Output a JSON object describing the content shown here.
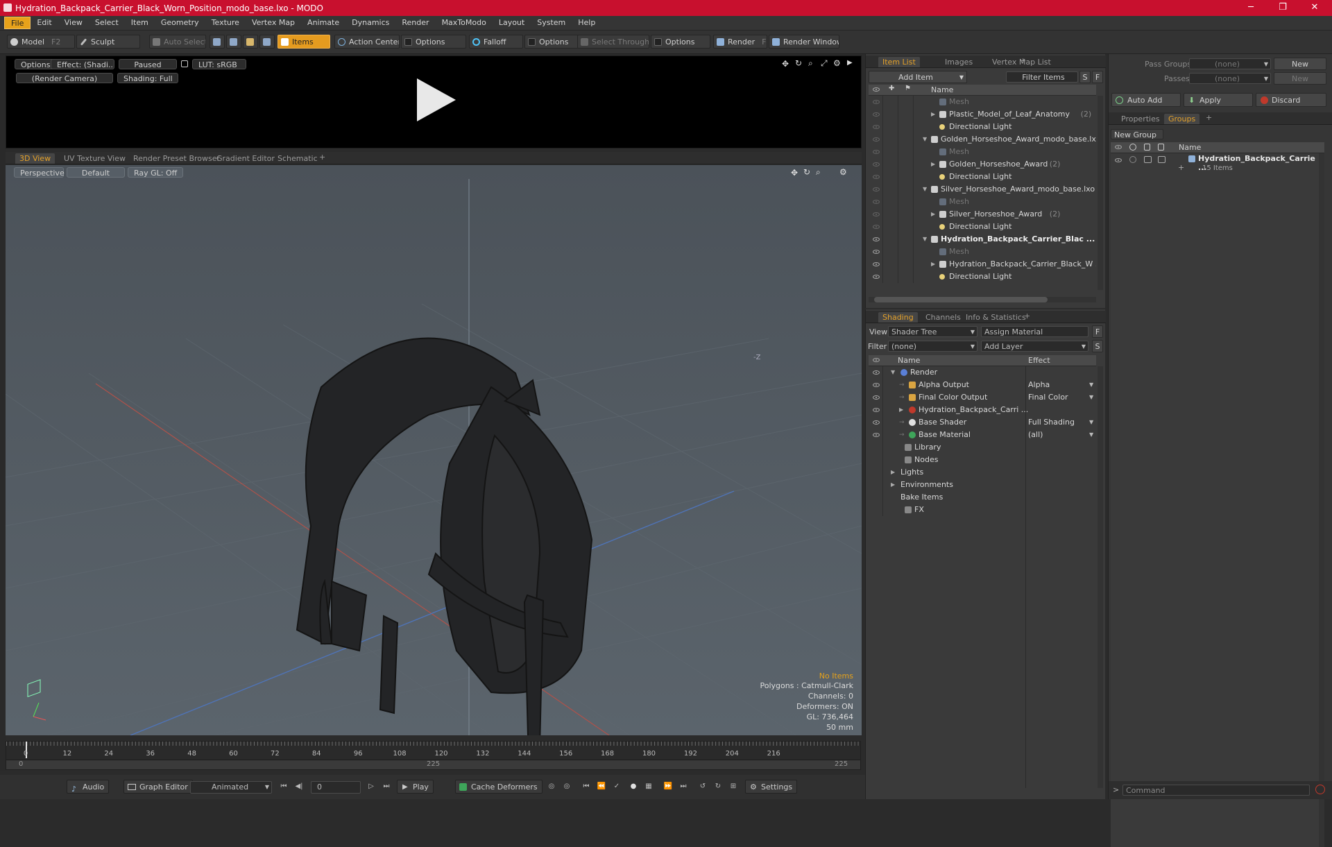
{
  "window": {
    "title": "Hydration_Backpack_Carrier_Black_Worn_Position_modo_base.lxo - MODO",
    "minimize": "─",
    "maximize": "❐",
    "close": "✕"
  },
  "menu": [
    "File",
    "Edit",
    "View",
    "Select",
    "Item",
    "Geometry",
    "Texture",
    "Vertex Map",
    "Animate",
    "Dynamics",
    "Render",
    "MaxToModo",
    "Layout",
    "System",
    "Help"
  ],
  "toolbar": {
    "model": "Model",
    "model_key": "F2",
    "sculpt": "Sculpt",
    "auto_select": "Auto Select",
    "items": "Items",
    "action_center": "Action Center",
    "options1": "Options",
    "falloff": "Falloff",
    "options2": "Options",
    "select_through": "Select Through",
    "options3": "Options",
    "render": "Render",
    "render_key": "F9",
    "render_window": "Render Window"
  },
  "preview": {
    "options": "Options",
    "effect": "Effect: (Shadi...",
    "paused": "Paused",
    "lut": "LUT: sRGB",
    "camera": "(Render Camera)",
    "shading": "Shading: Full"
  },
  "viewport_tabs": [
    "3D View",
    "UV Texture View",
    "Render Preset Browser",
    "Gradient Editor",
    "Schematic"
  ],
  "viewport": {
    "perspective": "Perspective",
    "default": "Default",
    "raygl": "Ray GL: Off",
    "axis_label": "-Z",
    "info": {
      "items": "No Items",
      "polygons": "Polygons : Catmull-Clark",
      "channels": "Channels: 0",
      "deformers": "Deformers: ON",
      "gl": "GL: 736,464",
      "size": "50 mm"
    }
  },
  "timeline": {
    "ticks": [
      "0",
      "12",
      "24",
      "36",
      "48",
      "60",
      "72",
      "84",
      "96",
      "108",
      "120",
      "132",
      "144",
      "156",
      "168",
      "180",
      "192",
      "204",
      "216"
    ],
    "start": "0",
    "mid": "225",
    "end": "225"
  },
  "bottombar": {
    "audio": "Audio",
    "graph_editor": "Graph Editor",
    "animated": "Animated",
    "frame": "0",
    "play": "Play",
    "cache": "Cache Deformers",
    "settings": "Settings"
  },
  "item_list": {
    "tabs": [
      "Item List",
      "Images",
      "Vertex Map List"
    ],
    "add_item": "Add Item",
    "filter": "Filter Items",
    "s": "S",
    "f": "F",
    "header_name": "Name",
    "rows": [
      {
        "label": "Mesh",
        "indent": 3,
        "kind": "mesh",
        "dim": true,
        "tri": ""
      },
      {
        "label": "Plastic_Model_of_Leaf_Anatomy",
        "count": "(2)",
        "indent": 3,
        "kind": "loc",
        "tri": "▶"
      },
      {
        "label": "Directional Light",
        "indent": 3,
        "kind": "light",
        "tri": ""
      },
      {
        "label": "Golden_Horseshoe_Award_modo_base.lxo",
        "indent": 2,
        "kind": "scene",
        "tri": "▼"
      },
      {
        "label": "Mesh",
        "indent": 3,
        "kind": "mesh",
        "dim": true,
        "tri": ""
      },
      {
        "label": "Golden_Horseshoe_Award",
        "count": "(2)",
        "indent": 3,
        "kind": "loc",
        "tri": "▶"
      },
      {
        "label": "Directional Light",
        "indent": 3,
        "kind": "light",
        "tri": ""
      },
      {
        "label": "Silver_Horseshoe_Award_modo_base.lxo",
        "indent": 2,
        "kind": "scene",
        "tri": "▼"
      },
      {
        "label": "Mesh",
        "indent": 3,
        "kind": "mesh",
        "dim": true,
        "tri": ""
      },
      {
        "label": "Silver_Horseshoe_Award",
        "count": "(2)",
        "indent": 3,
        "kind": "loc",
        "tri": "▶"
      },
      {
        "label": "Directional Light",
        "indent": 3,
        "kind": "light",
        "tri": ""
      },
      {
        "label": "Hydration_Backpack_Carrier_Blac ...",
        "indent": 2,
        "kind": "scene",
        "bold": true,
        "tri": "▼"
      },
      {
        "label": "Mesh",
        "indent": 3,
        "kind": "mesh",
        "dim": true,
        "tri": ""
      },
      {
        "label": "Hydration_Backpack_Carrier_Black_W ...",
        "indent": 3,
        "kind": "loc",
        "tri": "▶"
      },
      {
        "label": "Directional Light",
        "indent": 3,
        "kind": "light",
        "tri": ""
      }
    ]
  },
  "shading": {
    "tabs": [
      "Shading",
      "Channels",
      "Info & Statistics"
    ],
    "view_label": "View",
    "view_value": "Shader Tree",
    "assign": "Assign Material",
    "f": "F",
    "filter_label": "Filter",
    "filter_value": "(none)",
    "add_layer": "Add Layer",
    "s": "S",
    "col_name": "Name",
    "col_effect": "Effect",
    "rows": [
      {
        "label": "Render",
        "effect": "",
        "indent": 1,
        "tri": "▼",
        "icon": "#5a7fd6",
        "eye": true,
        "round": true
      },
      {
        "label": "Alpha Output",
        "effect": "Alpha",
        "indent": 2,
        "tri": "",
        "icon": "#d9a441",
        "eye": true
      },
      {
        "label": "Final Color Output",
        "effect": "Final Color",
        "indent": 2,
        "tri": "",
        "icon": "#d9a441",
        "eye": true
      },
      {
        "label": "Hydration_Backpack_Carri ...",
        "effect": "",
        "indent": 2,
        "tri": "▶",
        "icon": "#c0392b",
        "eye": true,
        "round": true
      },
      {
        "label": "Base Shader",
        "effect": "Full Shading",
        "indent": 2,
        "tri": "",
        "icon": "#e0e0e0",
        "eye": true,
        "round": true
      },
      {
        "label": "Base Material",
        "effect": "(all)",
        "indent": 2,
        "tri": "",
        "icon": "#3ea55a",
        "eye": true,
        "round": true
      },
      {
        "label": "Library",
        "effect": "",
        "indent": 1.5,
        "tri": "",
        "icon": "#888",
        "eye": false
      },
      {
        "label": "Nodes",
        "effect": "",
        "indent": 1.5,
        "tri": "",
        "icon": "#888",
        "eye": false
      },
      {
        "label": "Lights",
        "effect": "",
        "indent": 1,
        "tri": "▶",
        "icon": "",
        "eye": false
      },
      {
        "label": "Environments",
        "effect": "",
        "indent": 1,
        "tri": "▶",
        "icon": "",
        "eye": false
      },
      {
        "label": "Bake Items",
        "effect": "",
        "indent": 1,
        "tri": "",
        "icon": "",
        "eye": false
      },
      {
        "label": "FX",
        "effect": "",
        "indent": 1.5,
        "tri": "",
        "icon": "#888",
        "eye": false
      }
    ]
  },
  "right_panel": {
    "pass_groups": "Pass Groups",
    "pass_groups_value": "(none)",
    "new1": "New",
    "passes": "Passes",
    "passes_value": "(none)",
    "new2": "New",
    "auto_add": "Auto Add",
    "apply": "Apply",
    "discard": "Discard",
    "tabs": [
      "Properties",
      "Groups"
    ],
    "new_group": "New Group",
    "col_name": "Name",
    "group_name": "Hydration_Backpack_Carrie ...",
    "group_items": "15 Items",
    "command": "Command"
  }
}
